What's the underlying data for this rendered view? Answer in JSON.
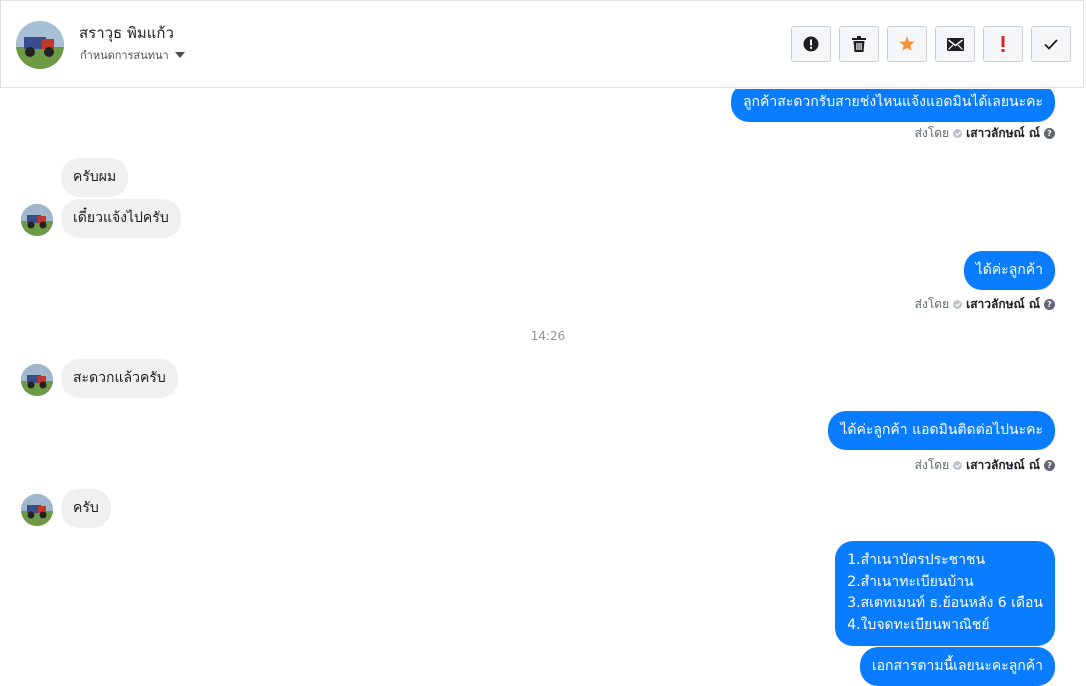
{
  "header": {
    "contact_name": "สราวุธ พิมแก้ว",
    "assign_label": "กำหนดการสนทนา",
    "actions": [
      {
        "icon": "alert-circle-icon",
        "color": "#1c1e21"
      },
      {
        "icon": "trash-icon",
        "color": "#1c1e21"
      },
      {
        "icon": "star-icon",
        "color": "#f7923b"
      },
      {
        "icon": "envelope-icon",
        "color": "#1c1e21"
      },
      {
        "icon": "exclamation-icon",
        "color": "#e02424"
      },
      {
        "icon": "check-icon",
        "color": "#1c1e21"
      }
    ]
  },
  "sent_by": {
    "prefix": "ส่งโดย",
    "agent": "เสาวลักษณ์ ณ์",
    "help": "?"
  },
  "messages": {
    "m1": "ลูกค้าสะดวกรับสายช่งไหนแจ้งแอดมินได้เลยนะคะ",
    "m2": "ครับผม",
    "m3": "เดี๋ยวแจ้งไปครับ",
    "m4": "ได้ค่ะลูกค้า",
    "time1": "14:26",
    "m5": "สะดวกแล้วครับ",
    "m6": "ได้ค่ะลูกค้า แอดมินติดต่อไปนะคะ",
    "m7": "ครับ",
    "m8": "1.สำเนาบัตรประชาชน\n2.สำเนาทะเบียนบ้าน\n3.สเตทเมนท์ ธ.ย้อนหลัง 6 เดือน\n4.ใบจดทะเบียนพาณิชย์",
    "m9": "เอกสารตามนี้เลยนะคะลูกค้า"
  },
  "colors": {
    "outgoing": "#0a7cff",
    "incoming": "#f1f0f0"
  }
}
